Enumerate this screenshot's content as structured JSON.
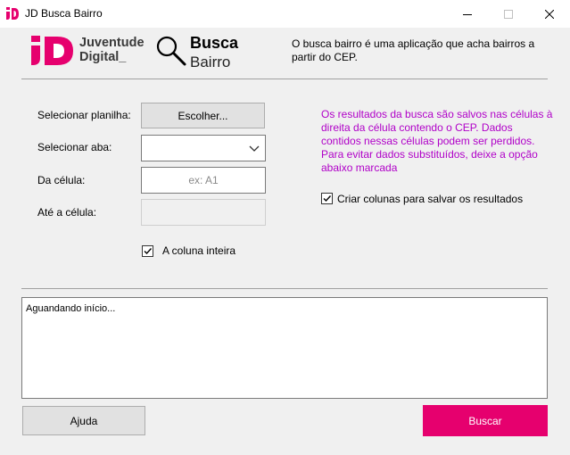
{
  "window": {
    "title": "JD Busca Bairro"
  },
  "header": {
    "logo_text_line1": "Juventude",
    "logo_text_line2": "Digital_",
    "app_name_line1": "Busca",
    "app_name_line2": "Bairro",
    "description": "O busca bairro é uma aplicação que acha bairros a partir do CEP."
  },
  "form": {
    "spreadsheet_label": "Selecionar planilha:",
    "choose_button": "Escolher...",
    "sheet_label": "Selecionar aba:",
    "sheet_value": "",
    "from_cell_label": "Da célula:",
    "from_cell_placeholder": "ex: A1",
    "to_cell_label": "Até a célula:",
    "to_cell_value": "",
    "whole_column_label": "A coluna inteira",
    "whole_column_checked": true
  },
  "info_text": "Os resultados da busca são salvos nas células à direita da célula contendo o CEP. Dados contidos nessas células podem ser perdidos. Para evitar dados substituídos, deixe a opção abaixo marcada",
  "create_columns": {
    "label": "Criar colunas para salvar os resultados",
    "checked": true
  },
  "log": {
    "text": "Aguandando início..."
  },
  "buttons": {
    "help": "Ajuda",
    "search": "Buscar"
  },
  "colors": {
    "brand_pink": "#e6006e",
    "info_purple": "#b000c8"
  }
}
